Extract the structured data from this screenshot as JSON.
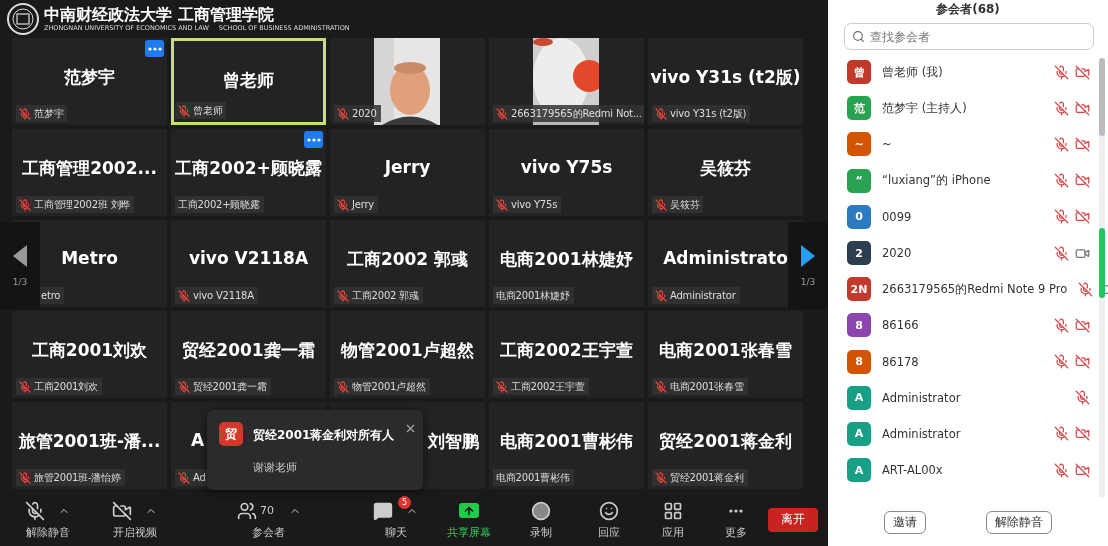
{
  "logo": {
    "title": "中南财经政法大学 工商管理学院",
    "subtitle_left": "ZHONGNAN UNIVERSITY OF ECONOMICS AND LAW",
    "subtitle_right": "SCHOOL OF BUSINESS ADMINISTRATION"
  },
  "tiles": [
    {
      "kind": "name",
      "name": "范梦宇",
      "label": "范梦宇",
      "muted": true,
      "more": true,
      "selected": false
    },
    {
      "kind": "name",
      "name": "曾老师",
      "label": "曾老师",
      "muted": true,
      "more": false,
      "selected": true
    },
    {
      "kind": "video",
      "label": "2020",
      "muted": true,
      "more": false,
      "selected": false
    },
    {
      "kind": "video",
      "label": "2663179565的Redmi Not...",
      "muted": true,
      "more": false,
      "selected": false
    },
    {
      "kind": "name",
      "name": "vivo Y31s (t2版)",
      "label": "vivo Y31s (t2版)",
      "muted": true,
      "more": false,
      "selected": false
    },
    {
      "kind": "name",
      "name": "工商管理2002...",
      "label": "工商管理2002班 刘晔",
      "muted": true,
      "more": false,
      "selected": false
    },
    {
      "kind": "name",
      "name": "工商2002+顾晓露",
      "label": "工商2002+顾晓露",
      "muted": false,
      "more": true,
      "selected": false
    },
    {
      "kind": "name",
      "name": "Jerry",
      "label": "Jerry",
      "muted": true,
      "more": false,
      "selected": false
    },
    {
      "kind": "name",
      "name": "vivo Y75s",
      "label": "vivo Y75s",
      "muted": true,
      "more": false,
      "selected": false
    },
    {
      "kind": "name",
      "name": "吴筱芬",
      "label": "吴筱芬",
      "muted": true,
      "more": false,
      "selected": false
    },
    {
      "kind": "name",
      "name": "Metro",
      "label": "etro",
      "more": false,
      "selected": false,
      "behind_nav": true
    },
    {
      "kind": "name",
      "name": "vivo V2118A",
      "label": "vivo V2118A",
      "muted": true,
      "more": false,
      "selected": false
    },
    {
      "kind": "name",
      "name": "工商2002 郭彧",
      "label": "工商2002 郭彧",
      "muted": true,
      "more": false,
      "selected": false
    },
    {
      "kind": "name",
      "name": "电商2001林婕妤",
      "label": "电商2001林婕妤",
      "muted": false,
      "more": false,
      "selected": false
    },
    {
      "kind": "name",
      "name": "Administrato",
      "label": "Administrator",
      "muted": true,
      "more": false,
      "selected": false
    },
    {
      "kind": "name",
      "name": "工商2001刘欢",
      "label": "工商2001刘欢",
      "muted": true,
      "more": false,
      "selected": false
    },
    {
      "kind": "name",
      "name": "贸经2001龚一霜",
      "label": "贸经2001龚一霜",
      "muted": true,
      "more": false,
      "selected": false
    },
    {
      "kind": "name",
      "name": "物管2001卢超然",
      "label": "物管2001卢超然",
      "muted": true,
      "more": false,
      "selected": false
    },
    {
      "kind": "name",
      "name": "工商2002王宇萱",
      "label": "工商2002王宇萱",
      "muted": true,
      "more": false,
      "selected": false
    },
    {
      "kind": "name",
      "name": "电商2001张春雪",
      "label": "电商2001张春雪",
      "muted": true,
      "more": false,
      "selected": false
    },
    {
      "kind": "name",
      "name": "旅管2001班-潘...",
      "label": "旅管2001班-潘怡婷",
      "muted": true,
      "more": false,
      "selected": false
    },
    {
      "kind": "name",
      "name": "A",
      "label": "Ad",
      "muted": true,
      "more": false,
      "selected": false,
      "name_left": true
    },
    {
      "kind": "name",
      "name": "刘智鹏",
      "more": false,
      "selected": false,
      "name_right": true
    },
    {
      "kind": "name",
      "name": "电商2001曹彬伟",
      "label": "电商2001曹彬伟",
      "muted": false,
      "more": false,
      "selected": false
    },
    {
      "kind": "name",
      "name": "贸经2001蒋金利",
      "label": "贸经2001蒋金利",
      "muted": true,
      "more": false,
      "selected": false
    }
  ],
  "pager": {
    "left": "1/3",
    "right": "1/3"
  },
  "notification": {
    "avatar": "贸",
    "title": "贸经2001蒋金利对所有人",
    "message": "谢谢老师"
  },
  "toolbar": [
    {
      "kind": "mic",
      "label": "解除静音",
      "caret": true
    },
    {
      "kind": "video",
      "label": "开启视频",
      "caret": true
    },
    {
      "kind": "participants",
      "label": "参会者",
      "count": "70",
      "caret": true
    },
    {
      "kind": "chat",
      "label": "聊天",
      "badge": "5",
      "caret": true
    },
    {
      "kind": "share",
      "label": "共享屏幕",
      "caret": false
    },
    {
      "kind": "record",
      "label": "录制",
      "caret": false
    },
    {
      "kind": "react",
      "label": "回应",
      "caret": false
    },
    {
      "kind": "apps",
      "label": "应用",
      "caret": false
    },
    {
      "kind": "more",
      "label": "更多",
      "caret": false
    }
  ],
  "leave_button": "离开",
  "panel": {
    "title": "参会者(68)",
    "search": {
      "placeholder": "查找参会者"
    },
    "participants": [
      {
        "avatar": "曾",
        "color": "#c0392b",
        "name": "曾老师 (我)",
        "mic_muted": true,
        "camera_off": true
      },
      {
        "avatar": "范",
        "color": "#27a352",
        "name": "范梦宇 (主持人)",
        "mic_muted": true,
        "camera_off": true
      },
      {
        "avatar": "~",
        "color": "#d35400",
        "name": "~",
        "mic_muted": true,
        "camera_off": true
      },
      {
        "avatar": "“",
        "color": "#27a352",
        "name": "“luxiang”的 iPhone",
        "mic_muted": true,
        "camera_off": true
      },
      {
        "avatar": "0",
        "color": "#2a7bbf",
        "name": "0099",
        "mic_muted": true,
        "camera_off": true
      },
      {
        "avatar": "2",
        "color": "#2c3e50",
        "name": "2020",
        "mic_muted": true,
        "camera_off": false
      },
      {
        "avatar": "2N",
        "color": "#c0392b",
        "name": "2663179565的Redmi Note 9 Pro",
        "mic_muted": true,
        "camera_off": false
      },
      {
        "avatar": "8",
        "color": "#8e44ad",
        "name": "86166",
        "mic_muted": true,
        "camera_off": true
      },
      {
        "avatar": "8",
        "color": "#d35400",
        "name": "86178",
        "mic_muted": true,
        "camera_off": true
      },
      {
        "avatar": "A",
        "color": "#17a085",
        "name": "Administrator",
        "mic_muted": true
      },
      {
        "avatar": "A",
        "color": "#17a085",
        "name": "Administrator",
        "mic_muted": true,
        "camera_off": true
      },
      {
        "avatar": "A",
        "color": "#17a085",
        "name": "ART-AL00x",
        "mic_muted": true,
        "camera_off": true
      }
    ],
    "buttons": [
      "邀请",
      "解除静音"
    ]
  }
}
